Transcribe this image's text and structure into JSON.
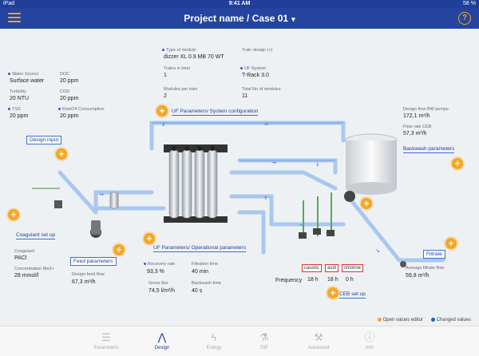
{
  "status": {
    "left": "iPad",
    "time": "9:41 AM",
    "right": "58 %"
  },
  "nav": {
    "title": "Project name / Case 01",
    "chevron": "▾",
    "help": "?"
  },
  "water": {
    "source_label": "Water Source",
    "source_value": "Surface water",
    "doc_label": "DOC",
    "doc_value": "20 ppm",
    "turbidity_label": "Turbidity",
    "turbidity_value": "20 NTU",
    "cod_label": "COD",
    "cod_value": "20 ppm",
    "tss_label": "TSS",
    "tss_value": "20 ppm",
    "kmno4_label": "KmnO4 Consumption",
    "kmno4_value": "20 ppm",
    "section": "Design input"
  },
  "module": {
    "type_label": "Type of module",
    "type_value": "dizzer XL 0.9 MB 70 WT",
    "train_label": "Train design (+)",
    "train_value": "",
    "trains_label": "Trains in total",
    "trains_value": "1",
    "uf_label": "UF System",
    "uf_value": "T-Rack 3.0",
    "perTrain_label": "Modules per train",
    "perTrain_value": "2",
    "total_label": "Total No of modules",
    "total_value": "11",
    "section": "UF Parameters/ System configuration"
  },
  "backwash": {
    "flow_label": "Design flow BW pumps",
    "flow_value": "172,1 m³/h",
    "ceb_label": "Flow rate CEB",
    "ceb_value": "57,3 m³/h",
    "section": "Backwash parameters"
  },
  "coagulant": {
    "section": "Coagulant set up",
    "coag_label": "Coagulant",
    "coag_value": "PACl",
    "conc_label": "Concentration Me3+",
    "conc_value": "28 mmol/l"
  },
  "feed": {
    "section": "Feed parameters",
    "flow_label": "Design feed flow",
    "flow_value": "67,3 m³/h"
  },
  "operational": {
    "section": "UF Parameters/ Operational parameters",
    "recovery_label": "Recovery rate",
    "recovery_value": "93,3 %",
    "filtration_label": "Filtration time",
    "filtration_value": "40 min",
    "gross_label": "Gross flux",
    "gross_value": "74,5 l/m²/h",
    "bwtime_label": "Backwash time",
    "bwtime_value": "40 s"
  },
  "ceb": {
    "tags": [
      "caustic",
      "acid",
      "chlorine"
    ],
    "frequency_label": "Frequency",
    "values": [
      "18 h",
      "18 h",
      "0 h"
    ],
    "section": "CEB set up"
  },
  "filtrate": {
    "section": "Filtrate",
    "flow_label": "Average filtrate flow",
    "flow_value": "59,8 m³/h"
  },
  "legend": {
    "open": "Open values editor",
    "changed": "Changed values",
    "open_color": "#f5a623",
    "changed_color": "#1f5fbf"
  },
  "tabs": [
    {
      "label": "Parameters",
      "icon": "sliders-icon",
      "glyph": "☰"
    },
    {
      "label": "Design",
      "icon": "compass-icon",
      "glyph": "⋀"
    },
    {
      "label": "Energy",
      "icon": "lightning-icon",
      "glyph": "ϟ"
    },
    {
      "label": "DIP",
      "icon": "flask-icon",
      "glyph": "⚗"
    },
    {
      "label": "Advanced",
      "icon": "tools-icon",
      "glyph": "⚒"
    },
    {
      "label": "Info",
      "icon": "info-icon",
      "glyph": "ⓘ"
    }
  ],
  "colors": {
    "nav": "#24449f",
    "accent": "#f5a623",
    "pipe": "#a9c8ef"
  }
}
